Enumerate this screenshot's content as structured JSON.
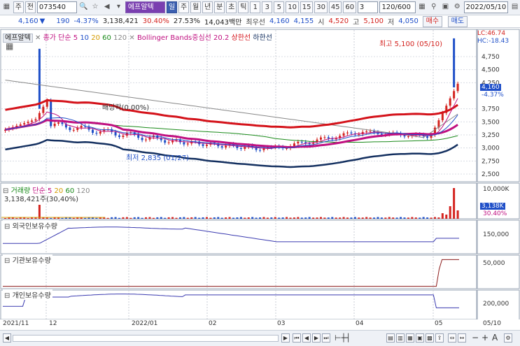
{
  "toolbar": {
    "type_btn": "주",
    "jeon_btn": "전",
    "code": "073540",
    "name": "에프알텍",
    "periods": [
      "일",
      "주",
      "월",
      "년",
      "분",
      "초",
      "틱"
    ],
    "minutes": [
      "1",
      "3",
      "5",
      "10",
      "15",
      "30",
      "45",
      "60"
    ],
    "unit": "3",
    "count": "120/600",
    "date": "2022/05/10"
  },
  "quote": {
    "price": "4,160",
    "change": "190",
    "change_pct": "-4.37%",
    "volume": "3,138,421",
    "vol_ratio": "30.40%",
    "turnover": "27.53%",
    "amount": "14,043백만",
    "best_label": "최우선",
    "best": "4,160",
    "best2": "4,155",
    "open_lbl": "시",
    "open": "4,520",
    "high_lbl": "고",
    "high": "5,100",
    "low_lbl": "저",
    "low": "4,050",
    "buy": "매수",
    "sell": "매도"
  },
  "legend": {
    "name": "에프알텍",
    "ma_label": "종가 단순",
    "ma": [
      "5",
      "10",
      "20",
      "60",
      "120"
    ],
    "bb": "Bollinger Bands중심선 20.2",
    "upper": "상한선",
    "lower": "하한선"
  },
  "annotations": {
    "high_note": "최고 5,100 (05/10)",
    "low_note": "최저 2,835 (01/27)",
    "exdiv": "배당락(0.00%)",
    "lc": "LC:46.74",
    "hc": "HC:-18.43",
    "cur_price": "4,160",
    "cur_pct": "-4.37%"
  },
  "price_axis": [
    "4,750",
    "4,500",
    "4,250",
    "3,750",
    "3,500",
    "3,250",
    "3,000",
    "2,750",
    "2,500"
  ],
  "volume_panel": {
    "title": "거래량",
    "ma_label": "단순",
    "ma": [
      "5",
      "20",
      "60",
      "120"
    ],
    "value": "3,138,421주(30,40%)",
    "axis": "10,000K",
    "tag": "3,138K",
    "tag2": "30.40%"
  },
  "foreign_panel": {
    "title": "외국인보유수량",
    "axis": "150,000"
  },
  "inst_panel": {
    "title": "기관보유수량",
    "axis": "50,000"
  },
  "indiv_panel": {
    "title": "개인보유수량",
    "axis": "200,000"
  },
  "dates": [
    "2021/11",
    "12",
    "2022/01",
    "02",
    "03",
    "04",
    "05",
    "05/10"
  ],
  "colors": {
    "up": "#d4231f",
    "down": "#1f4fc8",
    "bb_center": "#c01080",
    "bb_upper": "#d4121a",
    "bb_lower": "#143060"
  }
}
